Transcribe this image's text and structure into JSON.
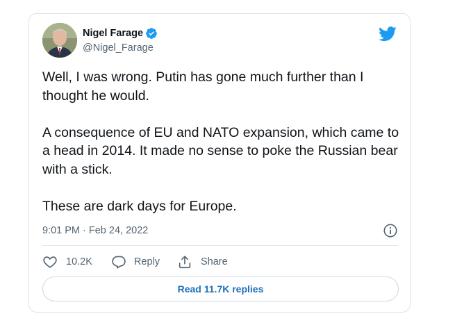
{
  "author": {
    "display_name": "Nigel Farage",
    "handle": "@Nigel_Farage",
    "verified": true
  },
  "tweet": {
    "paragraphs": [
      "Well, I was wrong. Putin has gone much further than I thought he would.",
      "A consequence of EU and NATO expansion, which came to a head in 2014. It made no sense to poke the Russian bear with a stick.",
      "These are dark days for Europe."
    ],
    "timestamp": "9:01 PM · Feb 24, 2022"
  },
  "actions": {
    "like_count": "10.2K",
    "reply_label": "Reply",
    "share_label": "Share"
  },
  "replies_button": "Read 11.7K replies",
  "colors": {
    "brand_blue": "#1d9bf0",
    "link_blue": "#1d70b8",
    "text": "#0f1419",
    "secondary_text": "#536471",
    "border": "#dfe3e7"
  },
  "icons": [
    "verified-badge-icon",
    "twitter-bird-icon",
    "info-icon",
    "heart-icon",
    "reply-bubble-icon",
    "share-icon"
  ]
}
